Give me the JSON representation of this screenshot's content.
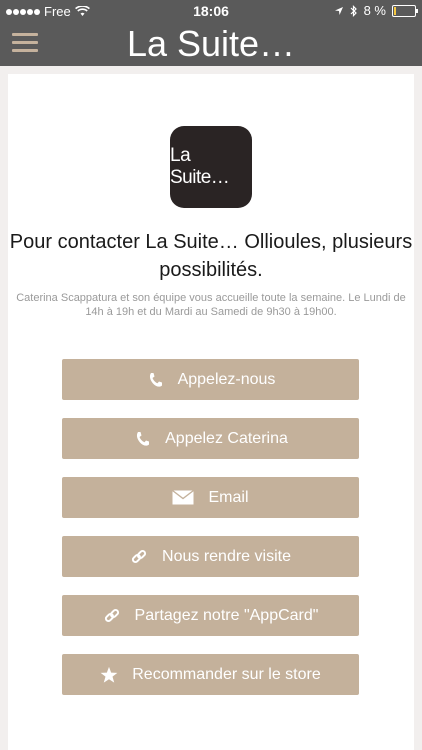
{
  "status_bar": {
    "carrier": "Free",
    "time": "18:06",
    "battery_text": "8 %",
    "battery_level": 0.08
  },
  "nav": {
    "title": "La Suite…",
    "menu_icon": "hamburger-icon"
  },
  "logo": {
    "text": "La Suite…"
  },
  "heading": "Pour contacter La Suite… Ollioules, plusieurs possibilités.",
  "description": "Caterina Scappatura et son équipe vous accueille toute la semaine. Le Lundi de 14h à 19h et du Mardi au Samedi de 9h30 à 19h00.",
  "buttons": [
    {
      "label": "Appelez-nous",
      "icon": "phone-icon"
    },
    {
      "label": "Appelez Caterina",
      "icon": "phone-icon"
    },
    {
      "label": "Email",
      "icon": "envelope-icon"
    },
    {
      "label": "Nous rendre visite",
      "icon": "link-icon"
    },
    {
      "label": "Partagez notre \"AppCard\"",
      "icon": "link-icon"
    },
    {
      "label": "Recommander sur le store",
      "icon": "star-icon"
    }
  ],
  "colors": {
    "nav_bg": "#5a5a5a",
    "button_bg": "#c4b19b",
    "menu_icon": "#c5b29d",
    "logo_bg": "#2a2424"
  }
}
